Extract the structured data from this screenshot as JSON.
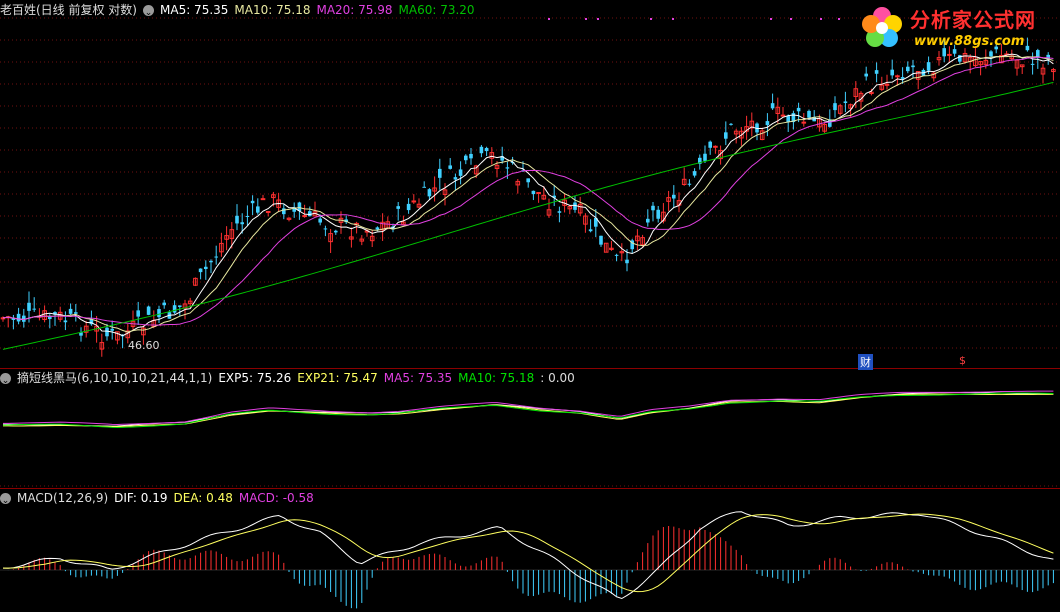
{
  "main": {
    "title": "老百姓(日线 前复权 对数)",
    "ma5": "MA5: 75.35",
    "ma10": "MA10: 75.18",
    "ma20": "MA20: 75.98",
    "ma60": "MA60: 73.20",
    "low_label": "46.60",
    "tag_finance": "财",
    "tag_dividend": "$",
    "colors": {
      "ma5": "#ffffff",
      "ma10": "#e8e8a0",
      "ma20": "#e040e0",
      "ma60": "#00c000",
      "up": "#ff3030",
      "down": "#40d0ff"
    }
  },
  "ind1": {
    "name": "摘短线黑马(6,10,10,10,21,44,1,1)",
    "exp5": "EXP5: 75.26",
    "exp21": "EXP21: 75.47",
    "ma5": "MA5: 75.35",
    "ma10": "MA10: 75.18",
    "extra": ": 0.00"
  },
  "macd": {
    "name": "MACD(12,26,9)",
    "dif": "DIF: 0.19",
    "dea": "DEA: 0.48",
    "macd": "MACD: -0.58"
  },
  "logo": {
    "text": "分析家公式网",
    "url": "www.88gs.com"
  }
}
